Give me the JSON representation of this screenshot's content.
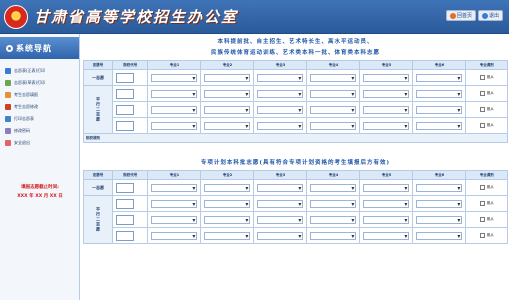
{
  "header": {
    "title": "甘肃省高等学校招生办公室",
    "actions": [
      {
        "label": "回首页",
        "icon": "home-icon"
      },
      {
        "label": "退出",
        "icon": "exit-icon"
      }
    ]
  },
  "sidebar": {
    "title": "系统导航",
    "items": [
      {
        "label": "志愿表(正表)打印",
        "icon": "printer-icon",
        "color": "#3a7bd5"
      },
      {
        "label": "志愿表(草表)打印",
        "icon": "document-icon",
        "color": "#6aa84f"
      },
      {
        "label": "考生志愿填报",
        "icon": "edit-icon",
        "color": "#e69138"
      },
      {
        "label": "考生志愿修改",
        "icon": "pencil-icon",
        "color": "#cc4125"
      },
      {
        "label": "打印志愿表",
        "icon": "printer-icon",
        "color": "#3d85c6"
      },
      {
        "label": "修改密码",
        "icon": "key-icon",
        "color": "#8e7cc3"
      },
      {
        "label": "安全退出",
        "icon": "logout-icon",
        "color": "#e06666"
      }
    ],
    "deadline_label": "填报志愿截止时间:",
    "deadline_value": "XXX 年 XX 月 XX 日"
  },
  "section1": {
    "title_line1": "本科提前批、自主招生、艺术特长生、高水平运动员、",
    "title_line2": "民族传统体育运动训练、艺术类本科一批、体育类本科志愿",
    "headers": [
      "志愿号",
      "院校代号",
      "专业1",
      "专业2",
      "专业3",
      "专业4",
      "专业5",
      "专业6",
      "专业调剂"
    ],
    "rows": [
      {
        "batch": "一志愿"
      },
      {
        "batch": "平行二志愿",
        "span": 3
      }
    ],
    "plan_label": "院校调剂",
    "adjust_label": "服从"
  },
  "section2": {
    "title": "专项计划本科批志愿(具有符合专项计划资格的考生填报后方有效)",
    "headers": [
      "志愿号",
      "院校代号",
      "专业1",
      "专业2",
      "专业3",
      "专业4",
      "专业5",
      "专业6",
      "专业调剂"
    ],
    "rows": [
      {
        "batch": "一志愿"
      },
      {
        "batch": "平行二志愿",
        "span": 3
      }
    ],
    "adjust_label": "服从"
  }
}
